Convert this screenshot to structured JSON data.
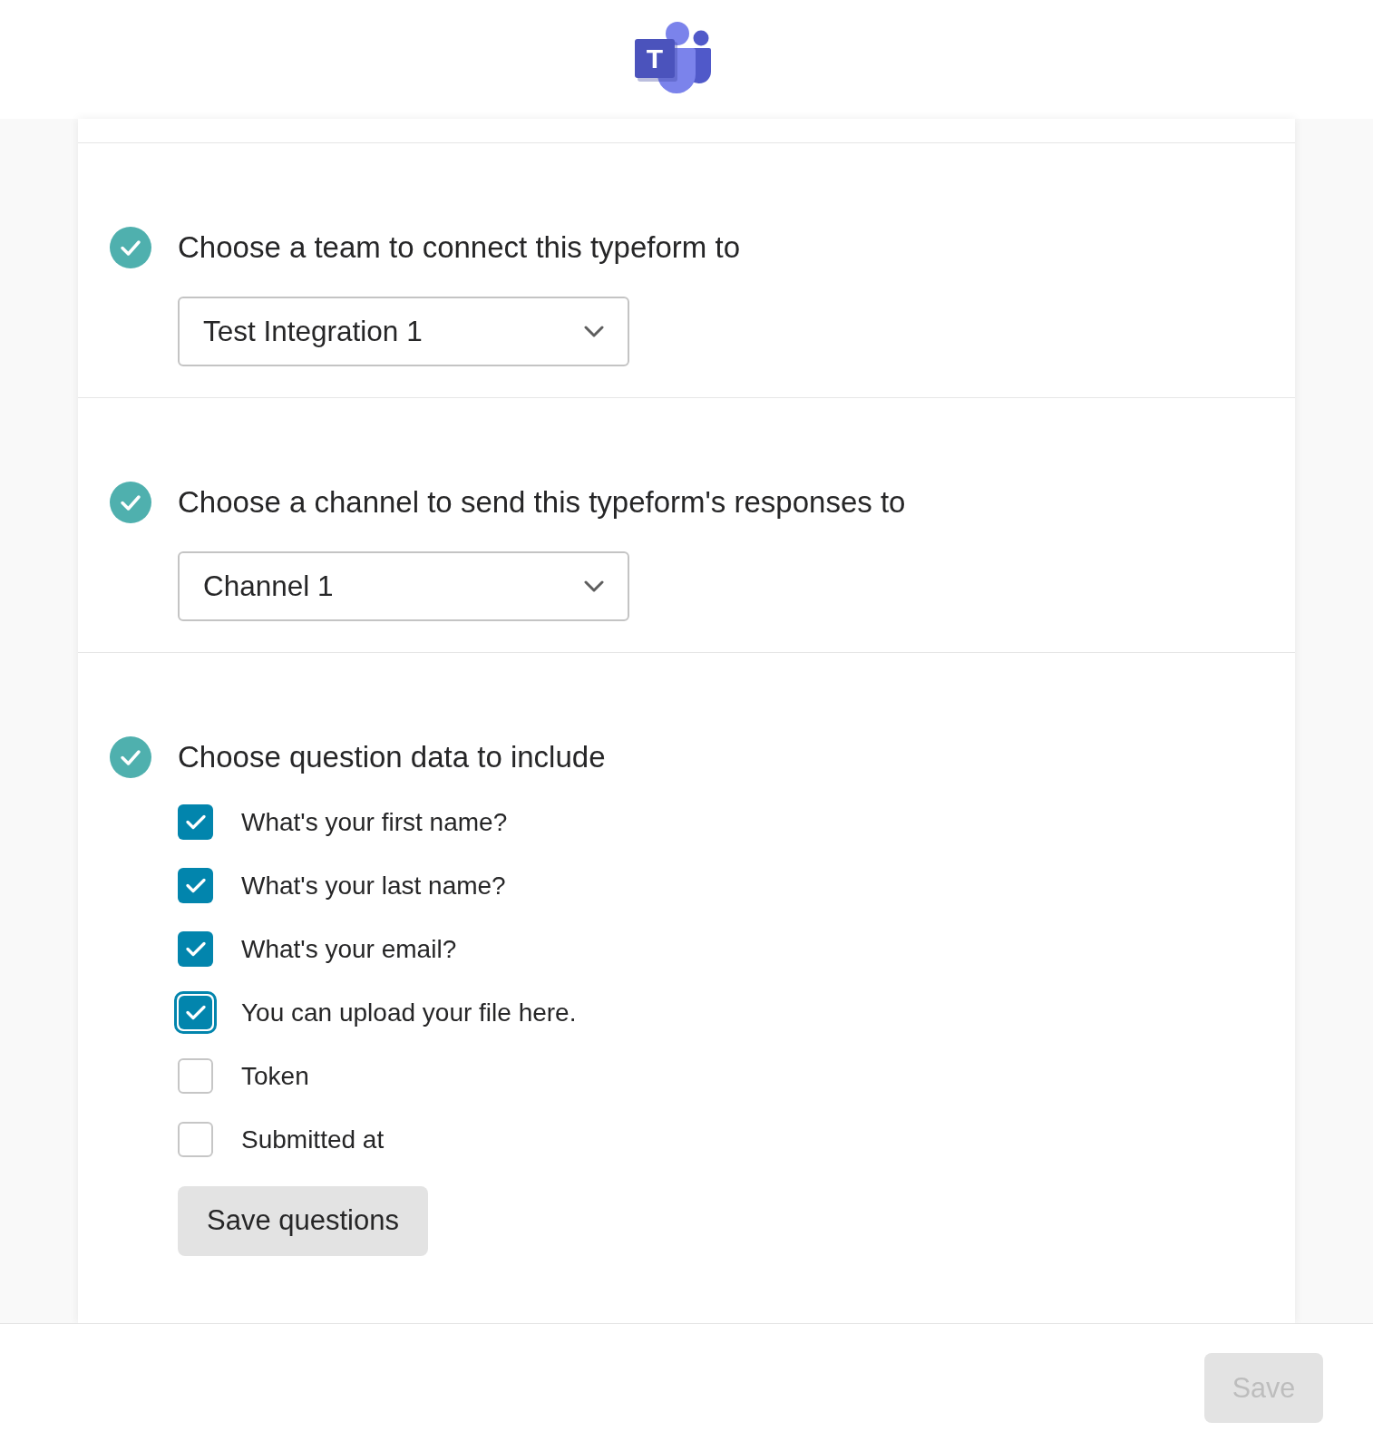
{
  "header": {
    "logo_letter": "T"
  },
  "steps": [
    {
      "kind": "select",
      "done": true,
      "title": "Choose a team to connect this typeform to",
      "value": "Test Integration 1"
    },
    {
      "kind": "select",
      "done": true,
      "title": "Choose a channel to send this typeform's responses to",
      "value": "Channel 1"
    },
    {
      "kind": "checklist",
      "done": true,
      "title": "Choose question data to include",
      "options": [
        {
          "label": "What's your first name?",
          "checked": true,
          "focused": false
        },
        {
          "label": "What's your last name?",
          "checked": true,
          "focused": false
        },
        {
          "label": "What's your email?",
          "checked": true,
          "focused": false
        },
        {
          "label": "You can upload your file here.",
          "checked": true,
          "focused": true
        },
        {
          "label": "Token",
          "checked": false,
          "focused": false
        },
        {
          "label": "Submitted at",
          "checked": false,
          "focused": false
        }
      ],
      "button": "Save questions"
    }
  ],
  "footer": {
    "save_button": {
      "label": "Save",
      "disabled": true
    }
  }
}
